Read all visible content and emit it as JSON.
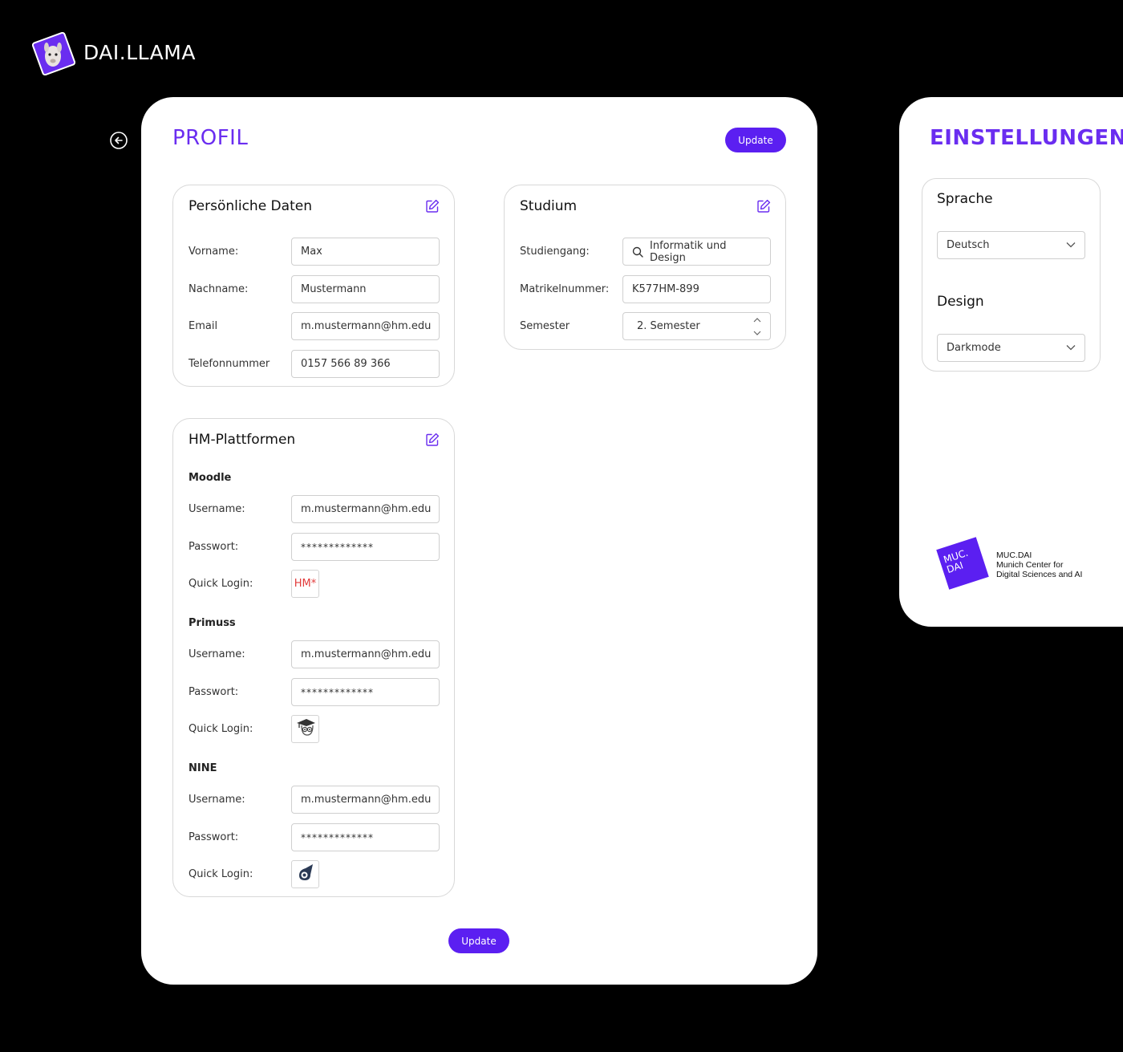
{
  "brand": {
    "name": "DAI.LLAMA"
  },
  "colors": {
    "accent": "#6a2df0",
    "button": "#5b1ff1",
    "background": "#000000"
  },
  "profile": {
    "title": "PROFIL",
    "update_label": "Update",
    "personal": {
      "title": "Persönliche Daten",
      "rows": [
        {
          "label": "Vorname:",
          "value": "Max"
        },
        {
          "label": "Nachname:",
          "value": "Mustermann"
        },
        {
          "label": "Email",
          "value": "m.mustermann@hm.edu"
        },
        {
          "label": "Telefonnummer",
          "value": "0157 566 89 366"
        }
      ]
    },
    "study": {
      "title": "Studium",
      "rows": [
        {
          "label": "Studiengang:",
          "value": "Informatik und Design",
          "icon": "search-icon"
        },
        {
          "label": "Matrikelnummer:",
          "value": "K577HM-899"
        },
        {
          "label": "Semester",
          "value": "2. Semester",
          "icon": "stepper-icon"
        }
      ]
    },
    "platforms": {
      "title": "HM-Plattformen",
      "groups": [
        {
          "name": "Moodle",
          "username_label": "Username:",
          "username": "m.mustermann@hm.edu",
          "password_label": "Passwort:",
          "password": "*************",
          "quick_login_label": "Quick Login:",
          "quick_login_icon": "HM*"
        },
        {
          "name": "Primuss",
          "username_label": "Username:",
          "username": "m.mustermann@hm.edu",
          "password_label": "Passwort:",
          "password": "*************",
          "quick_login_label": "Quick Login:",
          "quick_login_icon": "owl-graduation-icon"
        },
        {
          "name": "NINE",
          "username_label": "Username:",
          "username": "m.mustermann@hm.edu",
          "password_label": "Passwort:",
          "password": "*************",
          "quick_login_label": "Quick Login:",
          "quick_login_icon": "nine-logo-icon"
        }
      ]
    }
  },
  "settings": {
    "title": "EINSTELLUNGEN",
    "language_label": "Sprache",
    "language_value": "Deutsch",
    "design_label": "Design",
    "design_value": "Darkmode"
  },
  "footer_logo": {
    "mark_line1": "MUC.",
    "mark_line2": "DAI",
    "line1": "MUC.DAI",
    "line2": "Munich Center for",
    "line3": "Digital Sciences and AI"
  }
}
